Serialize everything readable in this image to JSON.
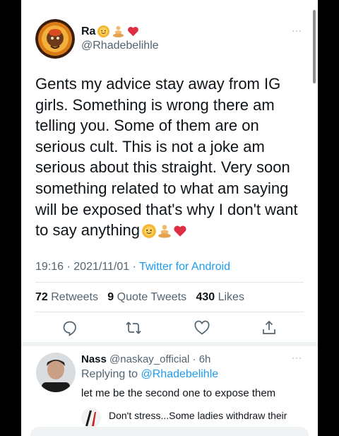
{
  "tweet": {
    "display_name": "Ra",
    "name_emojis": [
      "sun-emoji",
      "meditating-emoji",
      "red-heart-emoji"
    ],
    "handle": "@Rhadebelihle",
    "text": "Gents my advice stay away from IG girls. Something is wrong there am telling you. Some of them are on serious cult. This is not a joke am serious about this straight. Very soon something related to what am saying will be exposed that's why I don't want to say anything",
    "text_emojis": [
      "sun-emoji",
      "meditating-emoji",
      "red-heart-emoji"
    ],
    "time": "19:16",
    "date": "2021/11/01",
    "source": "Twitter for Android",
    "more_glyph": "···"
  },
  "stats": {
    "retweets_count": "72",
    "retweets_label": "Retweets",
    "quotes_count": "9",
    "quotes_label": "Quote Tweets",
    "likes_count": "430",
    "likes_label": "Likes"
  },
  "actions": [
    "reply-icon",
    "retweet-icon",
    "like-icon",
    "share-icon"
  ],
  "reply": {
    "name": "Nass",
    "handle": "@naskay_official",
    "age": "6h",
    "replying_prefix": "Replying to",
    "replying_to": "@Rhadebelihle",
    "text": "let me be the second one to expose them",
    "more_glyph": "···"
  },
  "next_reply": {
    "text": "Don't stress...Some ladies withdraw their"
  },
  "colors": {
    "accent": "#1d9bf0",
    "text": "#0f1419",
    "secondary": "#536471",
    "heart": "#e0245e"
  }
}
